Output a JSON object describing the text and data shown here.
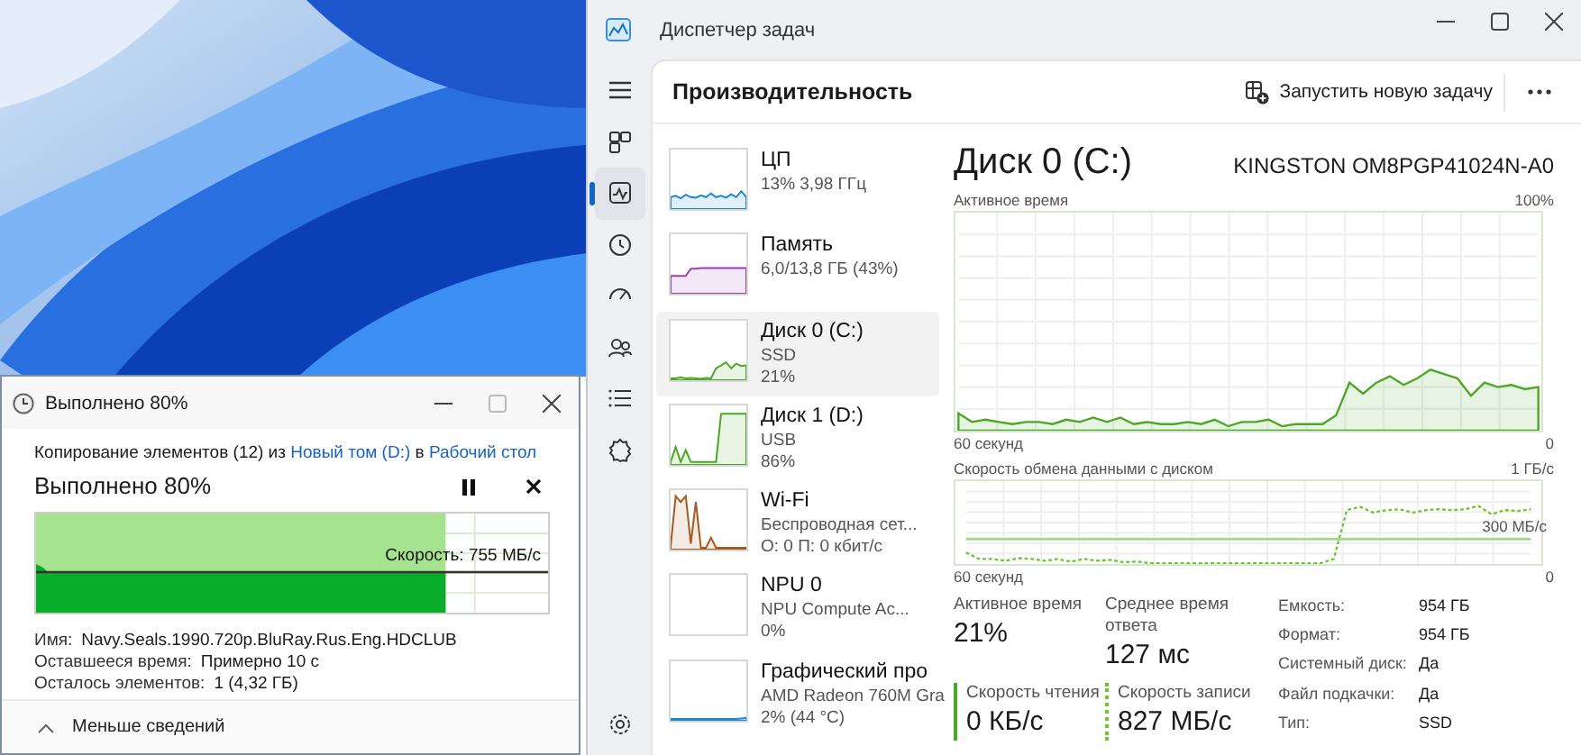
{
  "task_manager": {
    "window": {
      "title": "Диспетчер задач"
    },
    "nav_rail": [
      {
        "kind": "menu",
        "selected": false
      },
      {
        "kind": "processes",
        "selected": false
      },
      {
        "kind": "performance",
        "selected": true
      },
      {
        "kind": "history",
        "selected": false
      },
      {
        "kind": "startup",
        "selected": false
      },
      {
        "kind": "users",
        "selected": false
      },
      {
        "kind": "details",
        "selected": false
      },
      {
        "kind": "services",
        "selected": false
      },
      {
        "kind": "settings",
        "selected": false
      }
    ],
    "header": {
      "title": "Производительность",
      "run_task": "Запустить новую задачу"
    },
    "resources": [
      {
        "name": "ЦП",
        "lines": [
          "13%  3,98 ГГц"
        ],
        "color": "#1c86d6",
        "selected": false
      },
      {
        "name": "Память",
        "lines": [
          "6,0/13,8 ГБ (43%)"
        ],
        "color": "#9a3fc4",
        "selected": false
      },
      {
        "name": "Диск 0 (C:)",
        "lines": [
          "SSD",
          "21%"
        ],
        "color": "#4aa823",
        "selected": true
      },
      {
        "name": "Диск 1 (D:)",
        "lines": [
          "USB",
          "86%"
        ],
        "color": "#4aa823",
        "selected": false
      },
      {
        "name": "Wi-Fi",
        "lines": [
          "Беспроводная сет...",
          "О: 0 П: 0 кбит/с"
        ],
        "color": "#a65a1e",
        "selected": false
      },
      {
        "name": "NPU 0",
        "lines": [
          "NPU Compute Ac...",
          "0%"
        ],
        "selected": false
      },
      {
        "name": "Графический про",
        "lines": [
          "AMD Radeon 760M Gra",
          "2%  (44 °C)"
        ],
        "color": "#1c86d6",
        "selected": false
      }
    ],
    "detail": {
      "title": "Диск 0 (C:)",
      "model": "KINGSTON OM8PGP41024N-A0",
      "charts": [
        {
          "kind": "area",
          "title": "Активное время",
          "scale": "100%",
          "x_start": "60 секунд",
          "x_end": "0"
        },
        {
          "kind": "dashed",
          "title": "Скорость обмена данными с диском",
          "scale": "1 ГБ/с",
          "x_start": "60 секунд",
          "x_end": "0",
          "reference": "300 МБ/с"
        }
      ],
      "stats": [
        {
          "label": "Активное время",
          "value": "21%"
        },
        {
          "label": "Среднее время ответа",
          "value": "127 мс"
        }
      ],
      "rates": [
        {
          "kind": "read",
          "label": "Скорость чтения",
          "value": "0 КБ/с"
        },
        {
          "kind": "write",
          "label": "Скорость записи",
          "value": "827 МБ/с"
        }
      ],
      "properties": [
        {
          "label": "Емкость:",
          "value": "954 ГБ"
        },
        {
          "label": "Формат:",
          "value": "954 ГБ"
        },
        {
          "label": "Системный диск:",
          "value": "Да"
        },
        {
          "label": "Файл подкачки:",
          "value": "Да"
        },
        {
          "label": "Тип:",
          "value": "SSD"
        }
      ]
    }
  },
  "copy_dialog": {
    "window": {
      "title": "Выполнено 80%"
    },
    "description": [
      {
        "kind": "text",
        "text": "Копирование элементов (12) из "
      },
      {
        "kind": "link",
        "text": "Новый том (D:)"
      },
      {
        "kind": "text",
        "text": " в "
      },
      {
        "kind": "link",
        "text": "Рабочий стол"
      }
    ],
    "status": "Выполнено 80%",
    "level": 0.8,
    "speed": "Скорость: 755 МБ/с",
    "details": [
      {
        "label": "Имя:",
        "value": "Navy.Seals.1990.720p.BluRay.Rus.Eng.HDCLUB"
      },
      {
        "label": "Оставшееся время:",
        "value": "Примерно 10 с"
      },
      {
        "label": "Осталось элементов:",
        "value": "1 (4,32 ГБ)"
      }
    ],
    "footer": "Меньше сведений"
  }
}
